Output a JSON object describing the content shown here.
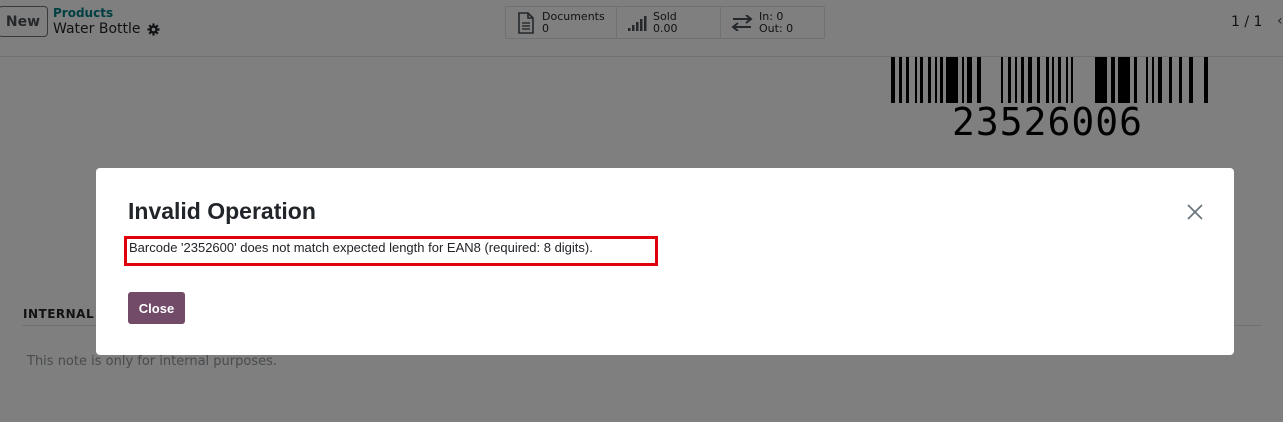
{
  "control_panel": {
    "new_label": "New",
    "breadcrumb": "Products",
    "record_name": "Water Bottle",
    "pager": "1 / 1",
    "pager_prev": "‹"
  },
  "smart_buttons": [
    {
      "icon": "document-icon",
      "label": "Documents",
      "value": "0"
    },
    {
      "icon": "chart-bars-icon",
      "label": "Sold",
      "value": "0.00"
    },
    {
      "icon": "exchange-arrows-icon",
      "label": "In: 0",
      "value": "Out: 0"
    }
  ],
  "form": {
    "barcode_value": "23526006",
    "section_label": "INTERNAL N",
    "internal_note_placeholder": "This note is only for internal purposes."
  },
  "dialog": {
    "title": "Invalid Operation",
    "message": "Barcode '2352600' does not match expected length for EAN8 (required: 8 digits).",
    "close_button_label": "Close",
    "highlight_color": "#e0000b",
    "primary_color": "#714b67"
  }
}
